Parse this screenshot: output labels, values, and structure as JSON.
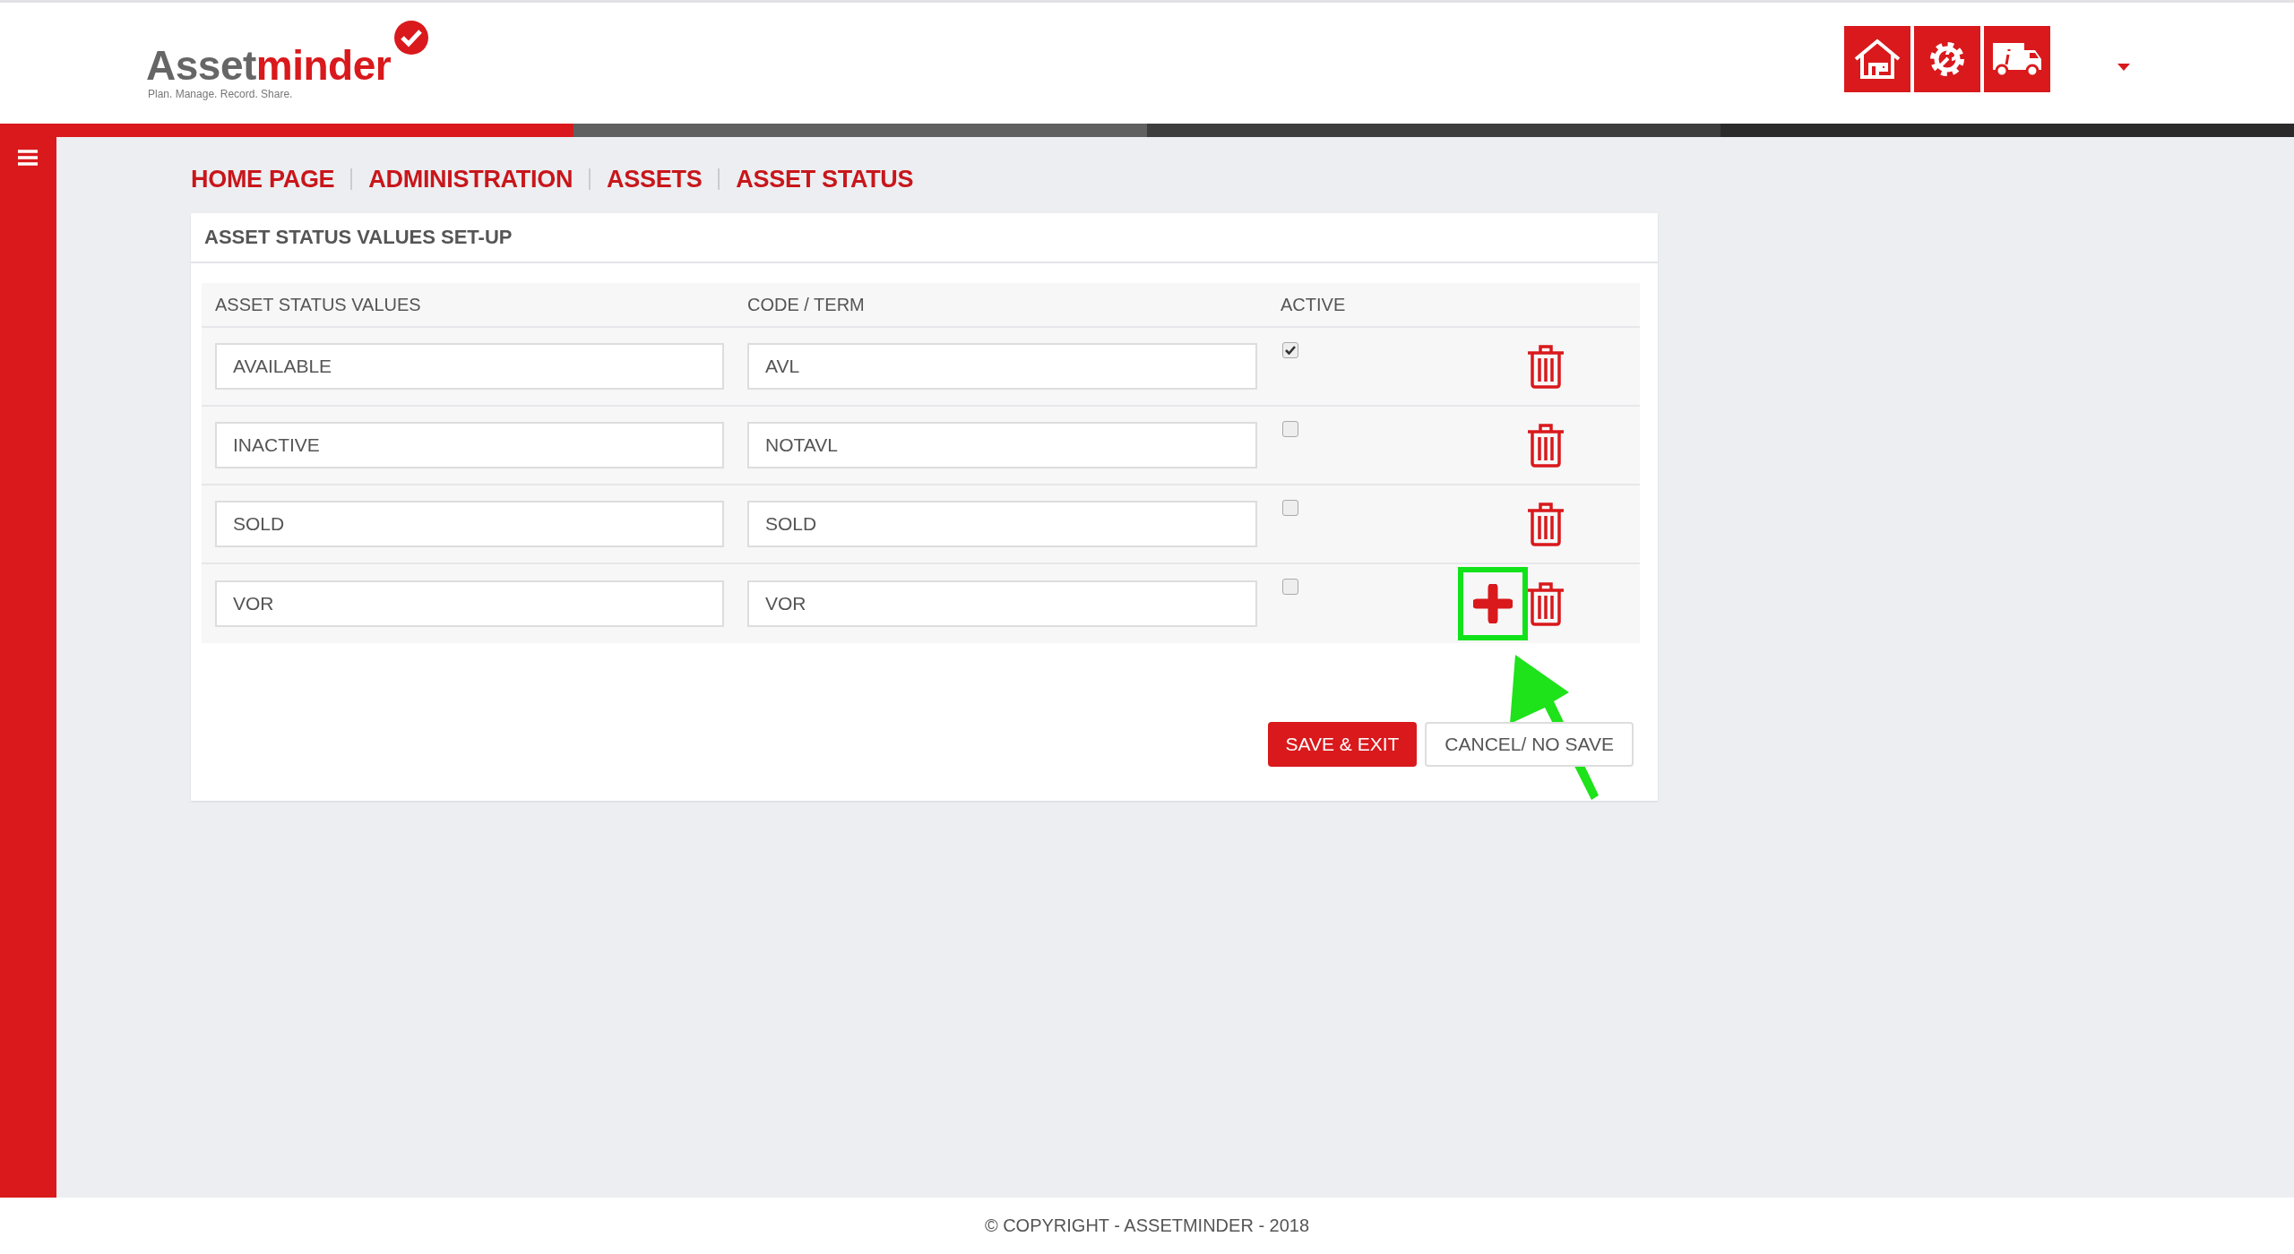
{
  "header": {
    "logo": {
      "name_part1": "Asset",
      "name_part2": "minder",
      "tagline": "Plan. Manage. Record. Share."
    }
  },
  "breadcrumb": [
    "HOME PAGE",
    "ADMINISTRATION",
    "ASSETS",
    "ASSET STATUS"
  ],
  "card": {
    "title": "ASSET STATUS VALUES SET-UP",
    "columns": [
      "ASSET STATUS VALUES",
      "CODE / TERM",
      "ACTIVE"
    ],
    "rows": [
      {
        "value": "AVAILABLE",
        "code": "AVL",
        "active": true,
        "add_button": false
      },
      {
        "value": "INACTIVE",
        "code": "NOTAVL",
        "active": false,
        "add_button": false
      },
      {
        "value": "SOLD",
        "code": "SOLD",
        "active": false,
        "add_button": false
      },
      {
        "value": "VOR",
        "code": "VOR",
        "active": false,
        "add_button": true,
        "highlighted": true
      }
    ],
    "buttons": [
      {
        "label": "SAVE & EXIT",
        "kind": "primary"
      },
      {
        "label": "CANCEL/ NO SAVE",
        "kind": "secondary"
      }
    ]
  },
  "footer": "© COPYRIGHT - ASSETMINDER - 2018"
}
